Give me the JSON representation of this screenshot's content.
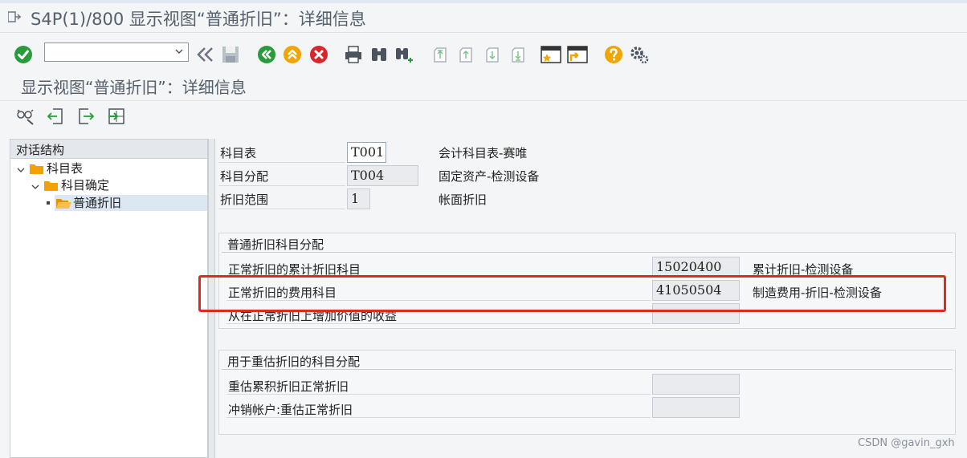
{
  "window": {
    "title": "S4P(1)/800 显示视图“普通折旧”：详细信息"
  },
  "toolbar": {
    "command_field_value": "",
    "icons": [
      "enter-icon",
      "back-nav-icon",
      "save-icon",
      "back-icon",
      "exit-icon",
      "cancel-icon",
      "print-icon",
      "find-icon",
      "find-next-icon",
      "first-page-icon",
      "prev-page-icon",
      "next-page-icon",
      "last-page-icon",
      "create-session-icon",
      "shortcut-icon",
      "help-icon",
      "settings-icon"
    ]
  },
  "screen": {
    "title": "显示视图“普通折旧”：详细信息"
  },
  "app_toolbar": {
    "icons": [
      "glasses-icon",
      "prev-entry-icon",
      "next-entry-icon",
      "variable-list-icon"
    ]
  },
  "tree": {
    "header": "对话结构",
    "items": [
      {
        "label": "科目表"
      },
      {
        "label": "科目确定"
      },
      {
        "label": "普通折旧"
      }
    ]
  },
  "header_fields": [
    {
      "label": "科目表",
      "value": "T001",
      "description": "会计科目表-赛唯"
    },
    {
      "label": "科目分配",
      "value": "T004",
      "description": "固定资产-检测设备"
    },
    {
      "label": "折旧范围",
      "value": "1",
      "description": "帐面折旧"
    }
  ],
  "group1": {
    "title": "普通折旧科目分配",
    "rows": [
      {
        "label": "正常折旧的累计折旧科目",
        "value": "15020400",
        "description": "累计折旧-检测设备"
      },
      {
        "label": "正常折旧的费用科目",
        "value": "41050504",
        "description": "制造费用-折旧-检测设备"
      },
      {
        "label": "从在正常折旧上增加价值的收益",
        "value": "",
        "description": ""
      }
    ]
  },
  "group2": {
    "title": "用于重估折旧的科目分配",
    "rows": [
      {
        "label": "重估累积折旧正常折旧",
        "value": ""
      },
      {
        "label": "冲销帐户:重估正常折旧",
        "value": ""
      }
    ]
  },
  "watermark": "CSDN @gavin_gxh",
  "colors": {
    "highlight": "#e0291f",
    "green": "#2a9b3a",
    "orange": "#f0a500",
    "red": "#d9262c",
    "folder": "#f4a100"
  }
}
